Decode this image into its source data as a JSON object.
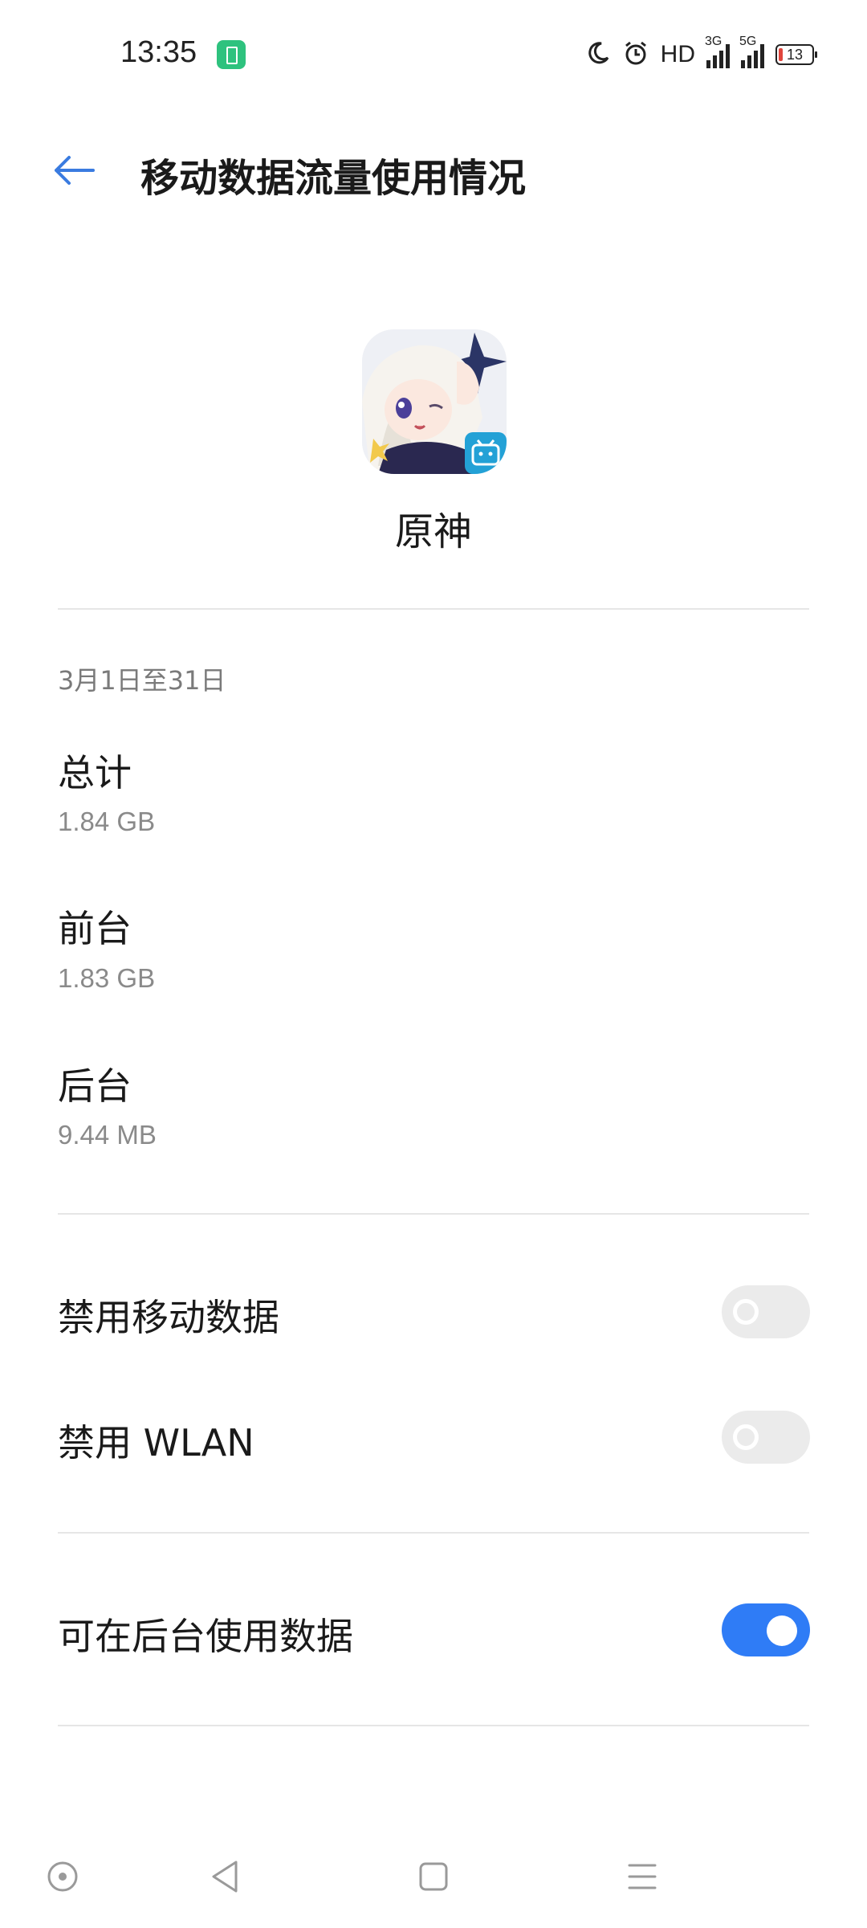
{
  "status_bar": {
    "time": "13:35",
    "hd_label": "HD",
    "signal_1": "3G",
    "signal_2": "5G",
    "battery": "13",
    "icons": [
      "charging-icon",
      "moon-icon",
      "alarm-icon",
      "signal-icon",
      "battery-icon"
    ]
  },
  "header": {
    "title": "移动数据流量使用情况",
    "back_icon": "back-arrow-icon"
  },
  "app": {
    "name": "原神",
    "icon": "genshin-app-icon"
  },
  "usage": {
    "date_range": "3月1日至31日",
    "total_label": "总计",
    "total_value": "1.84 GB",
    "foreground_label": "前台",
    "foreground_value": "1.83 GB",
    "background_label": "后台",
    "background_value": "9.44 MB"
  },
  "settings": {
    "disable_mobile_label": "禁用移动数据",
    "disable_mobile_enabled": false,
    "disable_wlan_label": "禁用 WLAN",
    "disable_wlan_enabled": false,
    "background_data_label": "可在后台使用数据",
    "background_data_enabled": true
  },
  "colors": {
    "accent": "#2f7cf6",
    "back_arrow": "#3a7be0",
    "toggle_off": "#ebebeb",
    "secondary_text": "#8a8a8a",
    "charging_badge": "#2ec27e",
    "battery_low": "#e0453c"
  },
  "nav_bar": {
    "icons": [
      "dot-circle-icon",
      "back-triangle-icon",
      "home-square-icon",
      "menu-lines-icon"
    ]
  }
}
